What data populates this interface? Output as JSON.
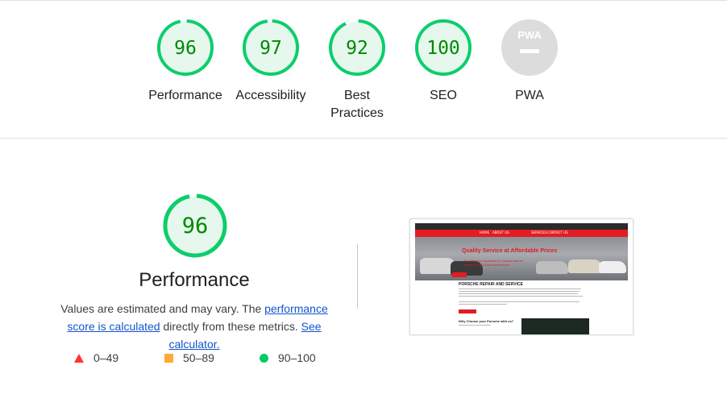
{
  "categories": [
    {
      "id": "performance",
      "score": "96",
      "label": "Performance",
      "fraction": 0.96,
      "color": "#0cce6b"
    },
    {
      "id": "accessibility",
      "score": "97",
      "label": "Accessibility",
      "fraction": 0.97,
      "color": "#0cce6b"
    },
    {
      "id": "best-practices",
      "score": "92",
      "label": "Best Practices",
      "fraction": 0.92,
      "color": "#0cce6b"
    },
    {
      "id": "seo",
      "score": "100",
      "label": "SEO",
      "fraction": 1.0,
      "color": "#0cce6b"
    },
    {
      "id": "pwa",
      "score": "—",
      "label": "PWA",
      "badge": "PWA",
      "color": "#bdbdbd"
    }
  ],
  "performance_section": {
    "score": "96",
    "fraction": 0.96,
    "title": "Performance",
    "desc_before": "Values are estimated and may vary. The ",
    "desc_link": "performance score is calculated",
    "desc_middle": " directly from these metrics. ",
    "calculator_link": "See calculator."
  },
  "legend": [
    {
      "range": "0–49",
      "shape": "triangle",
      "color": "#ff3333"
    },
    {
      "range": "50–89",
      "shape": "square",
      "color": "#ffaa33"
    },
    {
      "range": "90–100",
      "shape": "circle",
      "color": "#00cc66"
    }
  ],
  "screenshot": {
    "hero_title": "Quality Service at Affordable Prices",
    "hero_sub_1": "Your Porsche specialist for factory-trained",
    "hero_sub_2": "service, repair and maintenance",
    "section_title": "PORSCHE REPAIR AND SERVICE",
    "why_title": "Why Choose your Porsche with us?",
    "nav_items": [
      "HOME",
      "ABOUT US",
      "SERVICES",
      "CONTACT US"
    ]
  },
  "colors": {
    "pass": "#0cce6b",
    "pass_fill": "#e6f8ee",
    "pass_text": "#008800",
    "pwa_gray": "#bdbdbd"
  }
}
